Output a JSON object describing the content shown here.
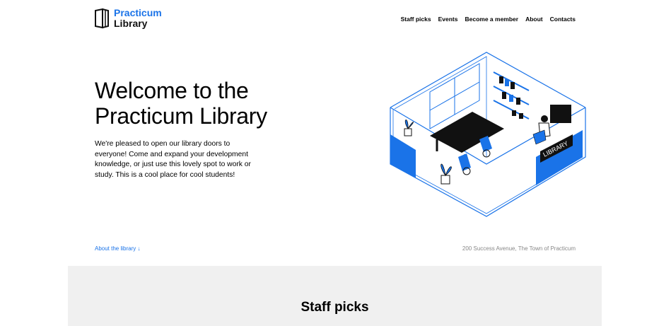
{
  "header": {
    "logo_line1": "Practicum",
    "logo_line2": "Library",
    "nav": [
      {
        "label": "Staff picks"
      },
      {
        "label": "Events"
      },
      {
        "label": "Become a member"
      },
      {
        "label": "About"
      },
      {
        "label": "Contacts"
      }
    ]
  },
  "hero": {
    "title": "Welcome to the Practicum Library",
    "text": "We're pleased to open our library doors to everyone! Come and expand your development knowledge, or just use this lovely spot to work or study. This is a cool place for cool students!",
    "sign_text": "LIBRARY"
  },
  "footer_bar": {
    "about_link": "About the library ↓",
    "address": "200 Success Avenue, The Town of Practicum"
  },
  "staff": {
    "title": "Staff picks"
  },
  "colors": {
    "accent": "#1a73e8",
    "section_bg": "#f0f0f0",
    "muted": "#888888"
  }
}
